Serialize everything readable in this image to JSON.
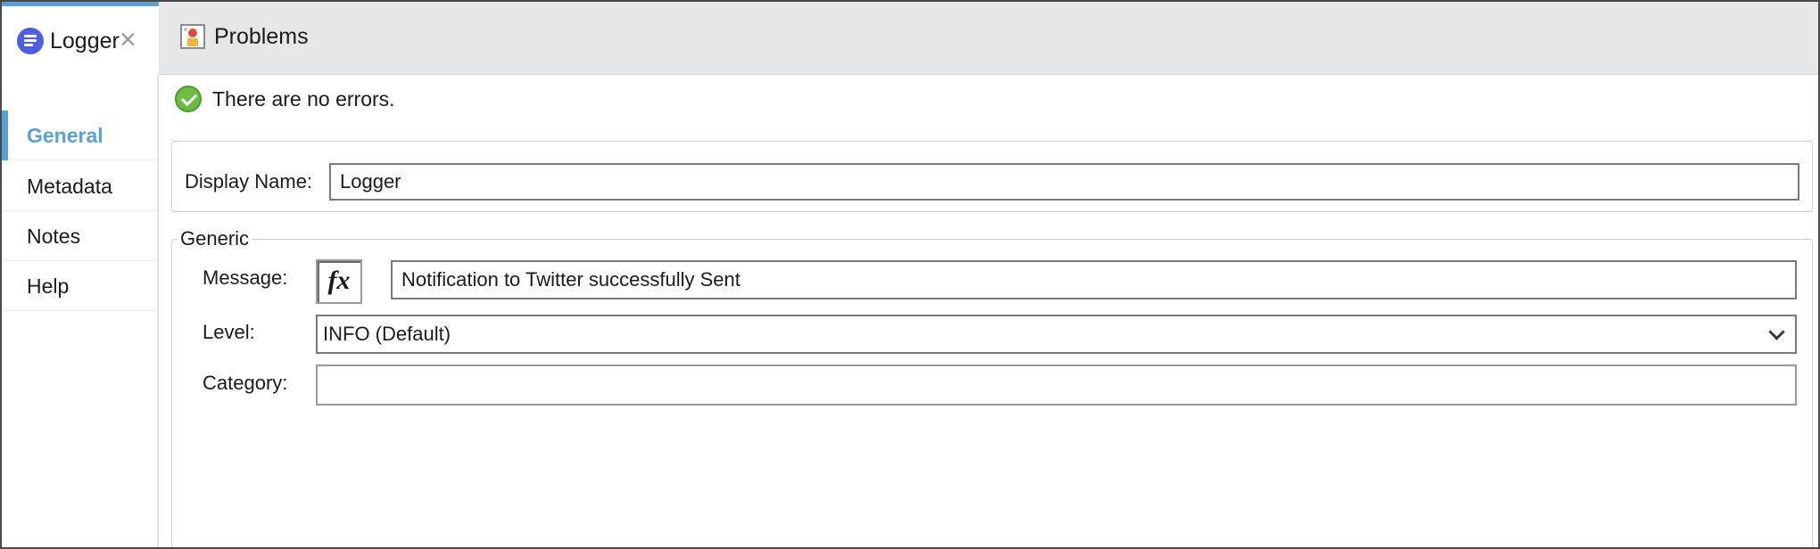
{
  "tabs": [
    {
      "label": "Logger",
      "icon": "logger-icon",
      "active": true,
      "closable": true
    },
    {
      "label": "Problems",
      "icon": "problems-icon",
      "active": false
    }
  ],
  "sidebar": {
    "items": [
      {
        "label": "General",
        "active": true
      },
      {
        "label": "Metadata"
      },
      {
        "label": "Notes"
      },
      {
        "label": "Help"
      }
    ]
  },
  "status": {
    "text": "There are no errors.",
    "icon": "check-circle-icon",
    "color": "#6cbb45"
  },
  "display_name": {
    "label": "Display Name:",
    "value": "Logger"
  },
  "generic": {
    "title": "Generic",
    "message": {
      "label": "Message:",
      "fx_label": "fx",
      "value": "Notification to Twitter successfully Sent"
    },
    "level": {
      "label": "Level:",
      "value": "INFO (Default)"
    },
    "category": {
      "label": "Category:",
      "value": ""
    }
  },
  "colors": {
    "accent": "#5aa0d6",
    "logger_icon": "#4b5fe0",
    "tabbar_bg": "#e6e7e8"
  }
}
